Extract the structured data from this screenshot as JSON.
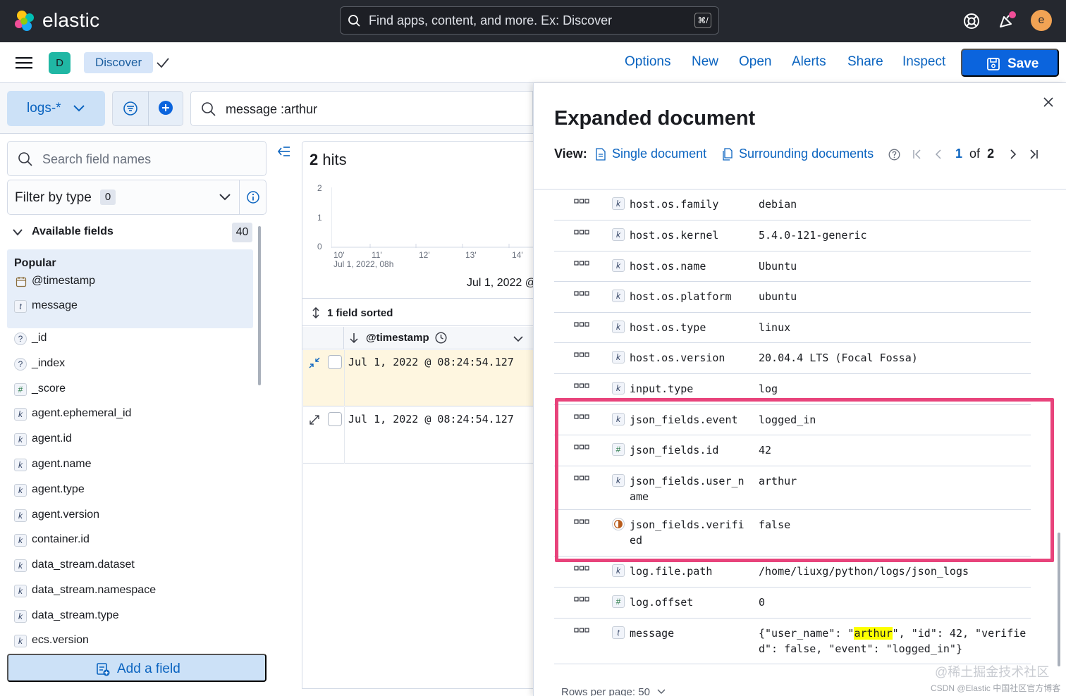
{
  "header": {
    "brand": "elastic",
    "search_placeholder": "Find apps, content, and more. Ex: Discover",
    "search_shortcut": "⌘/",
    "avatar_initial": "e",
    "colors": {
      "bg": "#25282f",
      "notification_dot": "#f04e98"
    }
  },
  "appbar": {
    "space_initial": "D",
    "breadcrumb": "Discover",
    "links": [
      "Options",
      "New",
      "Open",
      "Alerts",
      "Share",
      "Inspect"
    ],
    "save_label": "Save",
    "colors": {
      "accent": "#0b64dd",
      "space": "#20b7a4"
    }
  },
  "query": {
    "index_pattern": "logs-*",
    "text": "message :arthur"
  },
  "sidebar": {
    "search_placeholder": "Search field names",
    "filter_label": "Filter by type",
    "filter_count": "0",
    "available_label": "Available fields",
    "available_count": "40",
    "popular_title": "Popular",
    "popular_fields": [
      {
        "type": "date",
        "name": "@timestamp"
      },
      {
        "type": "t",
        "name": "message"
      }
    ],
    "fields": [
      {
        "type": "?",
        "name": "_id"
      },
      {
        "type": "?",
        "name": "_index"
      },
      {
        "type": "#",
        "name": "_score"
      },
      {
        "type": "k",
        "name": "agent.ephemeral_id"
      },
      {
        "type": "k",
        "name": "agent.id"
      },
      {
        "type": "k",
        "name": "agent.name"
      },
      {
        "type": "k",
        "name": "agent.type"
      },
      {
        "type": "k",
        "name": "agent.version"
      },
      {
        "type": "k",
        "name": "container.id"
      },
      {
        "type": "k",
        "name": "data_stream.dataset"
      },
      {
        "type": "k",
        "name": "data_stream.namespace"
      },
      {
        "type": "k",
        "name": "data_stream.type"
      },
      {
        "type": "k",
        "name": "ecs.version"
      }
    ],
    "add_field_label": "Add a field"
  },
  "main": {
    "hits_count": "2",
    "hits_label": "hits",
    "histogram": {
      "y_ticks": [
        "2",
        "1",
        "0"
      ],
      "x_ticks": [
        "10'",
        "11'",
        "12'",
        "13'",
        "14'"
      ],
      "x_date": "Jul 1, 2022, 08h",
      "caption": "Jul 1, 2022 @"
    },
    "sorted_label": "1 field sorted",
    "column_label": "@timestamp",
    "rows": [
      {
        "timestamp": "Jul 1, 2022 @ 08:24:54.127"
      },
      {
        "timestamp": "Jul 1, 2022 @ 08:24:54.127"
      }
    ]
  },
  "flyout": {
    "title": "Expanded document",
    "view_label": "View:",
    "single_doc": "Single document",
    "surrounding_docs": "Surrounding documents",
    "pager": {
      "current": "1",
      "of": "of",
      "total": "2"
    },
    "fields": [
      {
        "type": "k",
        "key": "host.os.family",
        "value": "debian"
      },
      {
        "type": "k",
        "key": "host.os.kernel",
        "value": "5.4.0-121-generic"
      },
      {
        "type": "k",
        "key": "host.os.name",
        "value": "Ubuntu"
      },
      {
        "type": "k",
        "key": "host.os.platform",
        "value": "ubuntu"
      },
      {
        "type": "k",
        "key": "host.os.type",
        "value": "linux"
      },
      {
        "type": "k",
        "key": "host.os.version",
        "value": "20.04.4 LTS (Focal Fossa)"
      },
      {
        "type": "k",
        "key": "input.type",
        "value": "log"
      },
      {
        "type": "k",
        "key": "json_fields.event",
        "value": "logged_in"
      },
      {
        "type": "#",
        "key": "json_fields.id",
        "value": "42"
      },
      {
        "type": "k",
        "key": "json_fields.user_name",
        "value": "arthur"
      },
      {
        "type": "bool",
        "key": "json_fields.verified",
        "value": "false"
      },
      {
        "type": "k",
        "key": "log.file.path",
        "value": "/home/liuxg/python/logs/json_logs"
      },
      {
        "type": "#",
        "key": "log.offset",
        "value": "0"
      },
      {
        "type": "t",
        "key": "message",
        "value_pre": "{\"user_name\": \"",
        "value_hl": "arthur",
        "value_post": "\", \"id\": 42, \"verified\": false, \"event\": \"logged_in\"}"
      }
    ],
    "rows_per_page": "Rows per page: 50",
    "highlight_color": "#e8437b"
  },
  "watermark": {
    "line1": "@稀土掘金技术社区",
    "line2": "CSDN @Elastic 中国社区官方博客"
  }
}
